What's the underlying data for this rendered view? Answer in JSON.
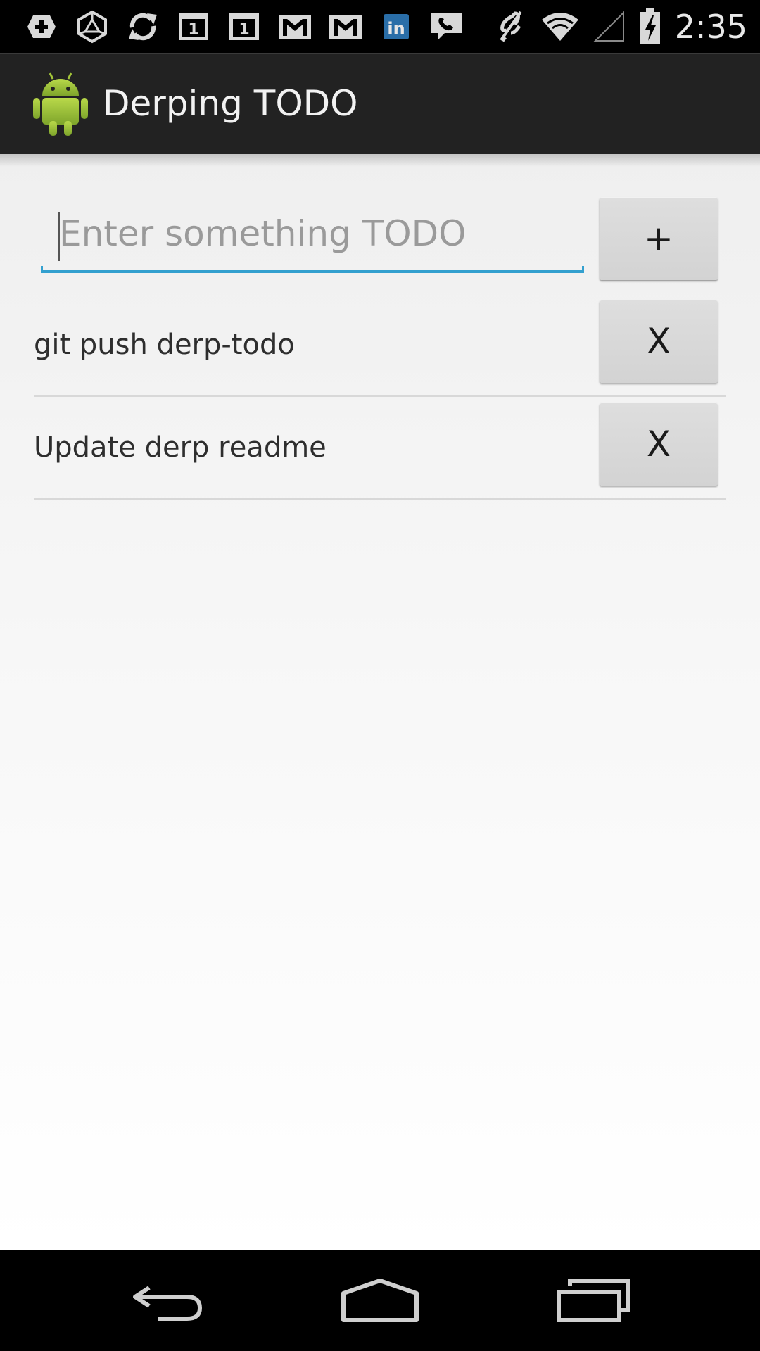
{
  "status_bar": {
    "time": "2:35",
    "left_icons": [
      "add-box-icon",
      "ingress-icon",
      "sync-icon",
      "calendar-1-icon",
      "calendar-1-icon",
      "gmail-icon",
      "gmail-icon",
      "linkedin-icon",
      "voicemail-icon"
    ],
    "calendar_day": "1",
    "linkedin_text": "in",
    "right_icons": [
      "vibrate-off-icon",
      "wifi-icon",
      "no-signal-icon",
      "battery-charging-icon"
    ]
  },
  "action_bar": {
    "title": "Derping TODO",
    "app_icon": "android-robot-icon",
    "colors": {
      "background": "#222222",
      "title": "#f2f2f2",
      "robot": "#a4c639"
    }
  },
  "new_todo": {
    "value": "",
    "placeholder": "Enter something TODO",
    "add_label": "+",
    "accent": "#33a0cf"
  },
  "todos": [
    {
      "text": "git push derp-todo",
      "delete_label": "X"
    },
    {
      "text": "Update derp readme",
      "delete_label": "X"
    }
  ],
  "nav_bar": {
    "buttons": [
      "back-icon",
      "home-icon",
      "recent-apps-icon"
    ]
  }
}
